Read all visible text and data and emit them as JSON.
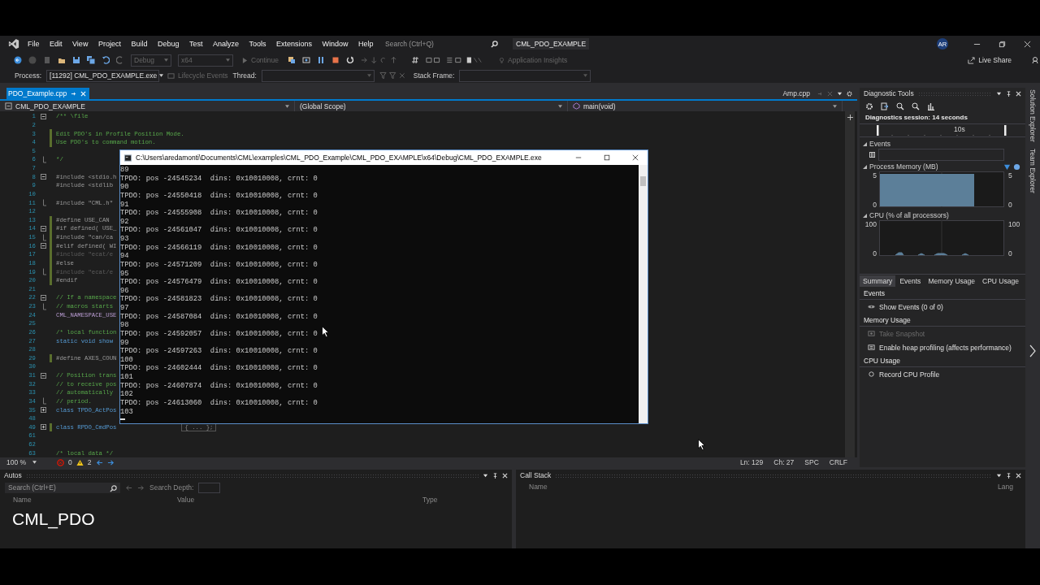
{
  "window": {
    "title": "CML_PDO_EXAMPLE",
    "avatar": "AR"
  },
  "menu": [
    "File",
    "Edit",
    "View",
    "Project",
    "Build",
    "Debug",
    "Test",
    "Analyze",
    "Tools",
    "Extensions",
    "Window",
    "Help"
  ],
  "search": {
    "placeholder": "Search (Ctrl+Q)"
  },
  "toolbar": {
    "configuration": "Debug",
    "platform": "x64",
    "continue": "Continue",
    "insights": "Application Insights",
    "live_share": "Live Share"
  },
  "debug_bar": {
    "process_label": "Process:",
    "process": "[11292] CML_PDO_EXAMPLE.exe",
    "lifecycle": "Lifecycle Events",
    "thread_label": "Thread:",
    "stack_label": "Stack Frame:"
  },
  "doc_tabs": [
    {
      "label": "PDO_Example.cpp",
      "selected": true
    }
  ],
  "right_tab": "Amp.cpp",
  "nav_bar": {
    "project": "CML_PDO_EXAMPLE",
    "scope": "(Global Scope)",
    "member": "main(void)"
  },
  "code": [
    {
      "n": "1",
      "text": "/** \\file",
      "kind": "comment",
      "expanded": true,
      "changed": false
    },
    {
      "n": "2",
      "changed": false
    },
    {
      "n": "3",
      "text": "Edit PDO's in Profile Position Mode.",
      "kind": "comment",
      "changed": true
    },
    {
      "n": "4",
      "text": "Use PDO's to command motion.",
      "kind": "comment",
      "changed": true
    },
    {
      "n": "5",
      "changed": false
    },
    {
      "n": "6",
      "text": "*/",
      "kind": "comment",
      "fold_end": true,
      "changed": false
    },
    {
      "n": "7",
      "changed": false
    },
    {
      "n": "8",
      "text": "#include <stdio.h",
      "kind": "preproc",
      "expanded": true,
      "changed": false
    },
    {
      "n": "9",
      "text": "#include <stdlib",
      "kind": "preproc",
      "changed": false
    },
    {
      "n": "10",
      "changed": false
    },
    {
      "n": "11",
      "text": "#include \"CML.h\"",
      "kind": "preproc",
      "fold_end": true,
      "changed": false
    },
    {
      "n": "12",
      "changed": false
    },
    {
      "n": "13",
      "text": "#define USE_CAN",
      "kind": "preproc",
      "changed": true
    },
    {
      "n": "14",
      "text": "#if defined( USE_",
      "kind": "preproc",
      "expanded": true,
      "changed": true
    },
    {
      "n": "15",
      "text": "#include \"can/ca",
      "kind": "preproc",
      "fold_end": true,
      "changed": true
    },
    {
      "n": "16",
      "text": "#elif defined( WI",
      "kind": "preproc",
      "expanded": true,
      "changed": true
    },
    {
      "n": "17",
      "text": "#include \"ecat/e",
      "kind": "inactive",
      "changed": true
    },
    {
      "n": "18",
      "text": "#else",
      "kind": "preproc",
      "changed": true
    },
    {
      "n": "19",
      "text": "#include \"ecat/e",
      "kind": "inactive",
      "fold_end": true,
      "changed": true
    },
    {
      "n": "20",
      "text": "#endif",
      "kind": "preproc",
      "changed": true
    },
    {
      "n": "21",
      "changed": false
    },
    {
      "n": "22",
      "text": "// If a namespace",
      "kind": "comment",
      "expanded": true,
      "changed": false
    },
    {
      "n": "23",
      "text": "// macros starts",
      "kind": "comment",
      "fold_end": true,
      "changed": false
    },
    {
      "n": "24",
      "text": "CML_NAMESPACE_USE",
      "kind": "macro",
      "changed": false
    },
    {
      "n": "25",
      "changed": false
    },
    {
      "n": "26",
      "text": "/* local function",
      "kind": "comment",
      "changed": false
    },
    {
      "n": "27",
      "text": "static void show",
      "kind": "keyword",
      "changed": false
    },
    {
      "n": "28",
      "changed": false
    },
    {
      "n": "29",
      "text": "#define AXES_COUN",
      "kind": "preproc",
      "changed": true
    },
    {
      "n": "30",
      "changed": false
    },
    {
      "n": "31",
      "text": "// Position trans",
      "kind": "comment",
      "expanded": true,
      "changed": false
    },
    {
      "n": "32",
      "text": "// to receive pos",
      "kind": "comment",
      "changed": false
    },
    {
      "n": "33",
      "text": "// automatically",
      "kind": "comment",
      "changed": false
    },
    {
      "n": "34",
      "text": "// period.",
      "kind": "comment",
      "fold_end": true,
      "changed": false
    },
    {
      "n": "35",
      "text": "class TPDO_ActPos",
      "kind": "keyword",
      "expanded": false,
      "changed": false
    },
    {
      "n": "48",
      "changed": false
    },
    {
      "n": "49",
      "text": "class RPDO_CmdPos",
      "kind": "keyword",
      "expanded": false,
      "changed": true,
      "hint": "{ ... };"
    },
    {
      "n": "61",
      "changed": false
    },
    {
      "n": "62",
      "changed": false
    },
    {
      "n": "63",
      "text": "/* local data */",
      "kind": "comment",
      "changed": false
    }
  ],
  "console": {
    "title": "C:\\Users\\aredamonti\\Documents\\CML\\examples\\CML_PDO_Example\\CML_PDO_EXAMPLE\\x64\\Debug\\CML_PDO_EXAMPLE.exe",
    "lines": [
      "89",
      "TPDO: pos -24545234  dins: 0x10010008, crnt: 0",
      "90",
      "TPDO: pos -24550418  dins: 0x10010008, crnt: 0",
      "91",
      "TPDO: pos -24555908  dins: 0x10010008, crnt: 0",
      "92",
      "TPDO: pos -24561047  dins: 0x10010008, crnt: 0",
      "93",
      "TPDO: pos -24566119  dins: 0x10010008, crnt: 0",
      "94",
      "TPDO: pos -24571209  dins: 0x10010008, crnt: 0",
      "95",
      "TPDO: pos -24576479  dins: 0x10010008, crnt: 0",
      "96",
      "TPDO: pos -24581823  dins: 0x10010008, crnt: 0",
      "97",
      "TPDO: pos -24587084  dins: 0x10010008, crnt: 0",
      "98",
      "TPDO: pos -24592057  dins: 0x10010008, crnt: 0",
      "99",
      "TPDO: pos -24597263  dins: 0x10010008, crnt: 0",
      "100",
      "TPDO: pos -24602444  dins: 0x10010008, crnt: 0",
      "101",
      "TPDO: pos -24607874  dins: 0x10010008, crnt: 0",
      "102",
      "TPDO: pos -24613060  dins: 0x10010008, crnt: 0",
      "103"
    ]
  },
  "editor_status": {
    "zoom": "100 %",
    "errors": "0",
    "warnings": "2",
    "line": "Ln: 129",
    "col": "Ch: 27",
    "spaces": "SPC",
    "eol": "CRLF"
  },
  "diagnostics": {
    "title": "Diagnostic Tools",
    "session": "Diagnostics session: 14 seconds",
    "timeline_label": "10s",
    "events_heading": "Events",
    "memory_heading": "Process Memory (MB)",
    "memory_axis": {
      "left_max": "5",
      "left_min": "0",
      "right_max": "5",
      "right_min": "0"
    },
    "cpu_heading": "CPU (% of all processors)",
    "cpu_axis": {
      "left_max": "100",
      "left_min": "0",
      "right_max": "100",
      "right_min": "0"
    },
    "tabs": [
      {
        "label": "Summary",
        "selected": true
      },
      {
        "label": "Events",
        "selected": false
      },
      {
        "label": "Memory Usage",
        "selected": false
      },
      {
        "label": "CPU Usage",
        "selected": false
      }
    ],
    "sections": [
      {
        "heading": "Events",
        "items": [
          {
            "label": "Show Events (0 of 0)",
            "kind": "events",
            "disabled": false
          }
        ]
      },
      {
        "heading": "Memory Usage",
        "items": [
          {
            "label": "Take Snapshot",
            "kind": "snapshot",
            "disabled": true
          },
          {
            "label": "Enable heap profiling (affects performance)",
            "kind": "heap",
            "disabled": false
          }
        ]
      },
      {
        "heading": "CPU Usage",
        "items": [
          {
            "label": "Record CPU Profile",
            "kind": "record",
            "disabled": false
          }
        ]
      }
    ]
  },
  "side_tabs": [
    "Solution Explorer",
    "Team Explorer"
  ],
  "autos": {
    "title": "Autos",
    "search": {
      "placeholder": "Search (Ctrl+E)"
    },
    "depth_label": "Search Depth:",
    "columns": [
      "Name",
      "Value",
      "Type"
    ]
  },
  "call_stack": {
    "title": "Call Stack",
    "columns": [
      "Name",
      "Lang"
    ]
  },
  "caption": "CML_PDO"
}
